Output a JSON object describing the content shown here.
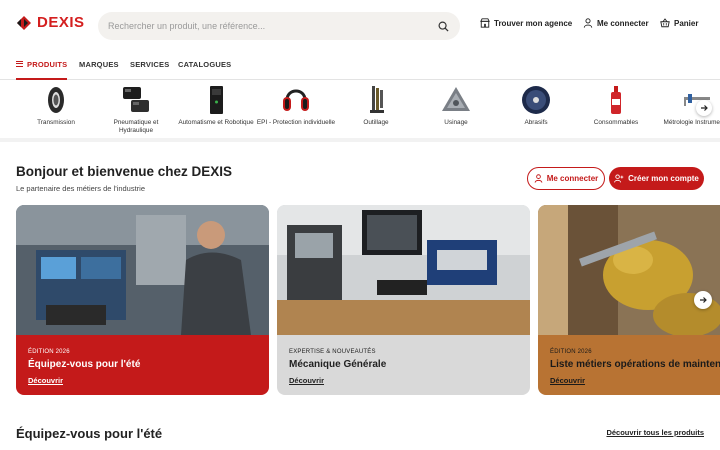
{
  "brand": {
    "name": "DEXIS",
    "accent_color": "#c41a1a"
  },
  "search": {
    "placeholder": "Rechercher un produit, une référence..."
  },
  "header_links": {
    "agency": "Trouver mon agence",
    "login": "Me connecter",
    "cart": "Panier"
  },
  "nav": {
    "items": [
      {
        "label": "PRODUITS",
        "active": true
      },
      {
        "label": "MARQUES",
        "active": false
      },
      {
        "label": "SERVICES",
        "active": false
      },
      {
        "label": "CATALOGUES",
        "active": false
      }
    ]
  },
  "categories": [
    {
      "label": "Transmission",
      "icon": "bearing-icon"
    },
    {
      "label": "Pneumatique et Hydraulique",
      "icon": "pneumatic-icon"
    },
    {
      "label": "Automatisme et Robotique",
      "icon": "automation-icon"
    },
    {
      "label": "EPI - Protection individuelle",
      "icon": "earmuff-icon"
    },
    {
      "label": "Outillage",
      "icon": "hex-keys-icon"
    },
    {
      "label": "Usinage",
      "icon": "insert-icon"
    },
    {
      "label": "Abrasifs",
      "icon": "disc-icon"
    },
    {
      "label": "Consommables",
      "icon": "bottle-icon"
    },
    {
      "label": "Métrologie Instruments",
      "icon": "caliper-icon"
    }
  ],
  "welcome": {
    "title": "Bonjour et bienvenue chez DEXIS",
    "subtitle": "Le partenaire des métiers de l'industrie",
    "login_button": "Me connecter",
    "create_account_button": "Créer mon compte"
  },
  "cards": [
    {
      "kicker": "ÉDITION 2026",
      "title": "Équipez-vous pour l'été",
      "link": "Découvrir"
    },
    {
      "kicker": "EXPERTISE & NOUVEAUTÉS",
      "title": "Mécanique Générale",
      "link": "Découvrir"
    },
    {
      "kicker": "ÉDITION 2026",
      "title": "Liste métiers opérations de maintenance",
      "link": "Découvrir"
    }
  ],
  "section": {
    "title": "Équipez-vous pour l'été",
    "link": "Découvrir tous les produits"
  }
}
